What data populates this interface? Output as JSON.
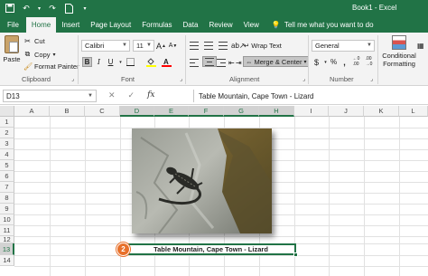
{
  "title_bar": {
    "title": "Book1 - Excel"
  },
  "tabs": [
    "File",
    "Home",
    "Insert",
    "Page Layout",
    "Formulas",
    "Data",
    "Review",
    "View"
  ],
  "tell_me": "Tell me what you want to do",
  "ribbon": {
    "clipboard": {
      "paste": "Paste",
      "cut": "Cut",
      "copy": "Copy",
      "format_painter": "Format Painter",
      "label": "Clipboard"
    },
    "font": {
      "font_name": "Calibri",
      "font_size": "11",
      "label": "Font"
    },
    "alignment": {
      "wrap_text": "Wrap Text",
      "merge_center": "Merge & Center",
      "label": "Alignment"
    },
    "number": {
      "format": "General",
      "label": "Number"
    },
    "styles": {
      "conditional_formatting": "Conditional Formatting"
    },
    "font_color": "#ff0000",
    "fill_color": "#ffff00"
  },
  "formula_bar": {
    "name_box": "D13",
    "content": "Table Mountain, Cape Town - Lizard"
  },
  "sheet": {
    "columns": [
      "A",
      "B",
      "C",
      "D",
      "E",
      "F",
      "G",
      "H",
      "I",
      "J",
      "K",
      "L"
    ],
    "rows": [
      "1",
      "2",
      "3",
      "4",
      "5",
      "6",
      "7",
      "8",
      "9",
      "10",
      "11",
      "12",
      "13",
      "14"
    ],
    "active_cell_text": "Table Mountain, Cape Town - Lizard",
    "step_badge": "2"
  },
  "accent_color": "#217346"
}
